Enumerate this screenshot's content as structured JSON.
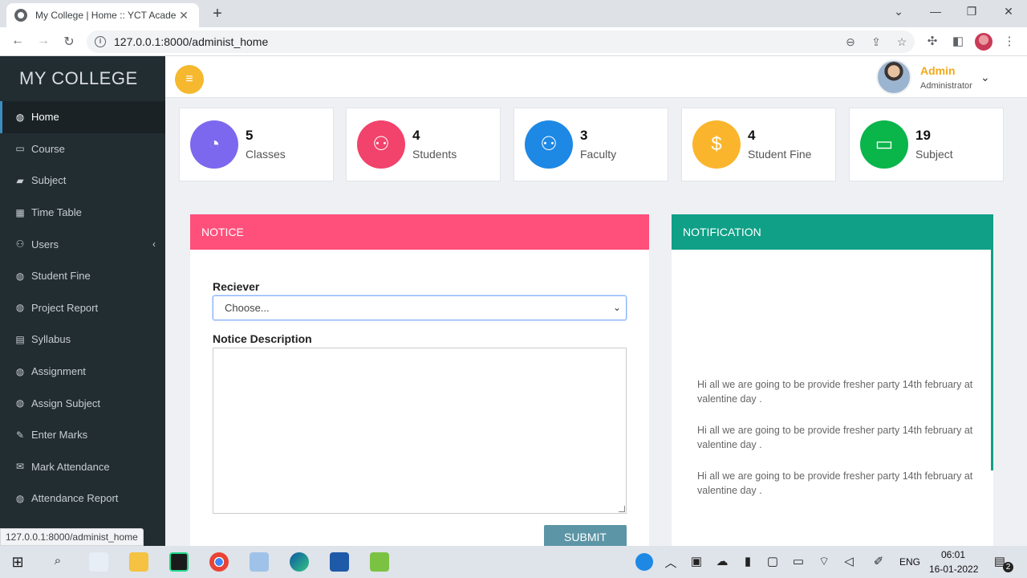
{
  "browser": {
    "tab_title": "My College | Home :: YCT Academ",
    "url": "127.0.0.1:8000/administ_home",
    "status_url": "127.0.0.1:8000/administ_home"
  },
  "sidebar": {
    "brand": "MY COLLEGE",
    "items": [
      {
        "label": "Home",
        "icon": "dashboard-icon",
        "glyph": "◍"
      },
      {
        "label": "Course",
        "icon": "laptop-icon",
        "glyph": "▭"
      },
      {
        "label": "Subject",
        "icon": "folder-icon",
        "glyph": "▰"
      },
      {
        "label": "Time Table",
        "icon": "grid-icon",
        "glyph": "▦"
      },
      {
        "label": "Users",
        "icon": "users-icon",
        "glyph": "⚇"
      },
      {
        "label": "Student Fine",
        "icon": "dashboard-icon",
        "glyph": "◍"
      },
      {
        "label": "Project Report",
        "icon": "dashboard-icon",
        "glyph": "◍"
      },
      {
        "label": "Syllabus",
        "icon": "table-icon",
        "glyph": "▤"
      },
      {
        "label": "Assignment",
        "icon": "dashboard-icon",
        "glyph": "◍"
      },
      {
        "label": "Assign Subject",
        "icon": "dashboard-icon",
        "glyph": "◍"
      },
      {
        "label": "Enter Marks",
        "icon": "edit-icon",
        "glyph": "✎"
      },
      {
        "label": "Mark Attendance",
        "icon": "envelope-icon",
        "glyph": "✉"
      },
      {
        "label": "Attendance Report",
        "icon": "dashboard-icon",
        "glyph": "◍"
      }
    ]
  },
  "header": {
    "user_name": "Admin",
    "user_role": "Administrator"
  },
  "stats": [
    {
      "value": "5",
      "label": "Classes",
      "color": "#7b68ee",
      "icon": "pie-chart-icon",
      "glyph": "◔"
    },
    {
      "value": "4",
      "label": "Students",
      "color": "#f1436b",
      "icon": "users-icon",
      "glyph": "⚇"
    },
    {
      "value": "3",
      "label": "Faculty",
      "color": "#1e88e5",
      "icon": "users-icon",
      "glyph": "⚇"
    },
    {
      "value": "4",
      "label": "Student Fine",
      "color": "#fbb52c",
      "icon": "dollar-icon",
      "glyph": "$"
    },
    {
      "value": "19",
      "label": "Subject",
      "color": "#0ab54a",
      "icon": "laptop-icon",
      "glyph": "▭"
    }
  ],
  "notice": {
    "title": "NOTICE",
    "receiver_label": "Reciever",
    "receiver_value": "Choose...",
    "description_label": "Notice Description",
    "submit_label": "SUBMIT"
  },
  "notification": {
    "title": "NOTIFICATION",
    "messages": [
      "Hi all we are going to be provide fresher party 14th february at valentine day .",
      "Hi all we are going to be provide fresher party 14th february at valentine day .",
      "Hi all we are going to be provide fresher party 14th february at valentine day ."
    ]
  },
  "taskbar": {
    "language": "ENG",
    "time": "06:01",
    "date": "16-01-2022",
    "notification_count": "2"
  }
}
